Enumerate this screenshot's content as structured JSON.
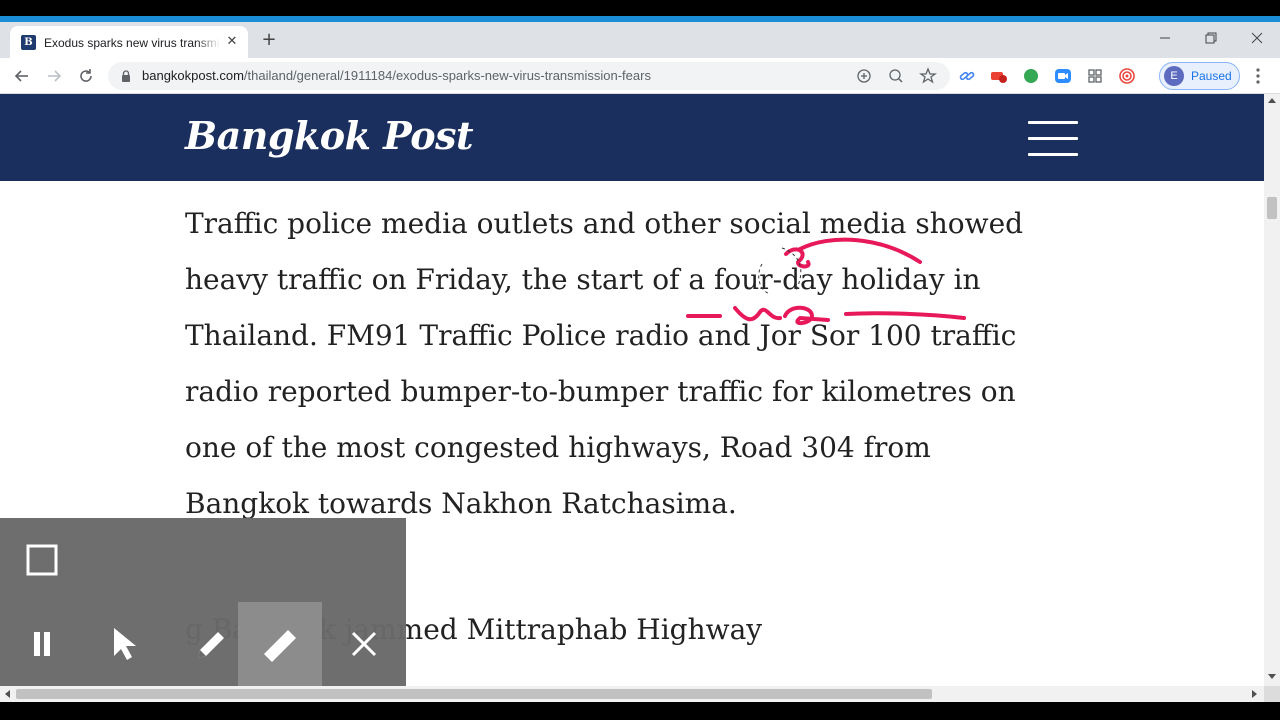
{
  "browser": {
    "tab_title": "Exodus sparks new virus transmission fears",
    "tab_favicon_letter": "B",
    "new_tab_symbol": "+",
    "close_symbol": "✕",
    "url_domain": "bangkokpost.com",
    "url_path": "/thailand/general/1911184/exodus-sparks-new-virus-transmission-fears",
    "profile_initial": "E",
    "profile_status": "Paused",
    "extension_colors": [
      "#4285f4",
      "#ea4335",
      "#34a853",
      "#2d8cff",
      "#5f6368",
      "#e8473f"
    ]
  },
  "site": {
    "logo": "Bangkok Post",
    "brand_color": "#1b2f5e"
  },
  "article": {
    "lines": [
      "Traffic police media outlets and other social media showed",
      "heavy traffic on Friday, the start of a four-day holiday in",
      "Thailand. FM91 Traffic Police radio and Jor Sor 100 traffic",
      "radio reported bumper-to-bumper traffic for kilometres on",
      "one of the most congested highways, Road 304 from",
      "Bangkok towards Nakhon Ratchasima.",
      "",
      "g Bangkok jammed Mittraphab Highway"
    ]
  },
  "annotation_toolbar": {
    "tools": [
      "pause-icon",
      "pointer-icon",
      "pen-icon",
      "highlighter-icon",
      "close-icon"
    ],
    "active_tool": "highlighter-icon",
    "ink_color": "#e8195a"
  }
}
